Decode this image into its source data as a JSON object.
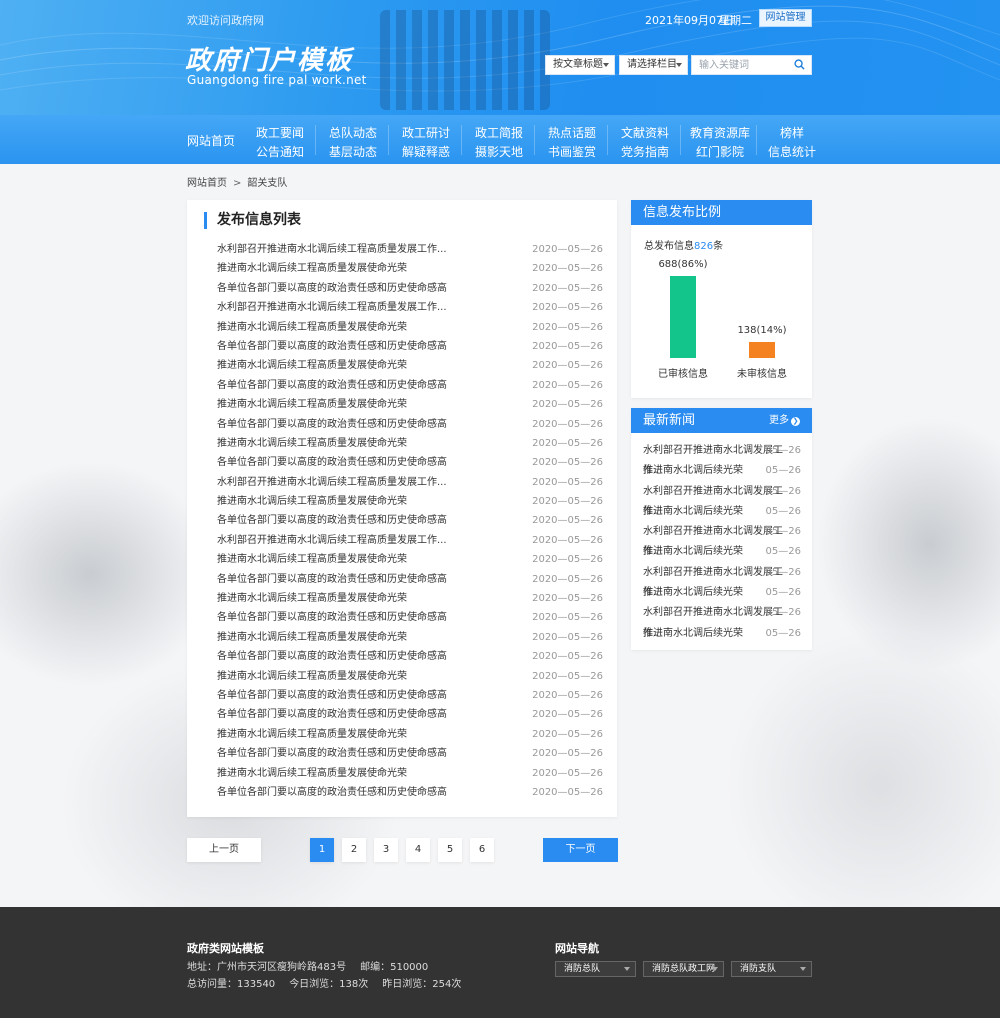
{
  "header": {
    "welcome": "欢迎访问政府网",
    "logo_title": "政府门户模板",
    "logo_sub": "Guangdong fire pal work.net",
    "date": "2021年09月07日",
    "week": "星期二",
    "admin_label": "网站管理",
    "select_title": "按文章标题",
    "select_column": "请选择栏目",
    "search_placeholder": "输入关键词"
  },
  "nav": {
    "home": "网站首页",
    "columns": [
      {
        "top": "政工要闻",
        "bottom": "公告通知"
      },
      {
        "top": "总队动态",
        "bottom": "基层动态"
      },
      {
        "top": "政工研讨",
        "bottom": "解疑释惑"
      },
      {
        "top": "政工简报",
        "bottom": "摄影天地"
      },
      {
        "top": "热点话题",
        "bottom": "书画鉴赏"
      },
      {
        "top": "文献资料",
        "bottom": "党务指南"
      },
      {
        "top": "教育资源库",
        "bottom": "红门影院"
      },
      {
        "top": "榜样",
        "bottom": "信息统计"
      }
    ]
  },
  "breadcrumb": {
    "home": "网站首页",
    "sep": ">",
    "current": "韶关支队"
  },
  "list": {
    "title": "发布信息列表",
    "rows": [
      {
        "title": "水利部召开推进南水北调后续工程高质量发展工作...",
        "date": "2020—05—26"
      },
      {
        "title": "推进南水北调后续工程高质量发展使命光荣",
        "date": "2020—05—26"
      },
      {
        "title": "各单位各部门要以高度的政治责任感和历史使命感高",
        "date": "2020—05—26"
      },
      {
        "title": "水利部召开推进南水北调后续工程高质量发展工作...",
        "date": "2020—05—26"
      },
      {
        "title": "推进南水北调后续工程高质量发展使命光荣",
        "date": "2020—05—26"
      },
      {
        "title": "各单位各部门要以高度的政治责任感和历史使命感高",
        "date": "2020—05—26"
      },
      {
        "title": "推进南水北调后续工程高质量发展使命光荣",
        "date": "2020—05—26"
      },
      {
        "title": "各单位各部门要以高度的政治责任感和历史使命感高",
        "date": "2020—05—26"
      },
      {
        "title": "推进南水北调后续工程高质量发展使命光荣",
        "date": "2020—05—26"
      },
      {
        "title": "各单位各部门要以高度的政治责任感和历史使命感高",
        "date": "2020—05—26"
      },
      {
        "title": "推进南水北调后续工程高质量发展使命光荣",
        "date": "2020—05—26"
      },
      {
        "title": "各单位各部门要以高度的政治责任感和历史使命感高",
        "date": "2020—05—26"
      },
      {
        "title": "水利部召开推进南水北调后续工程高质量发展工作...",
        "date": "2020—05—26"
      },
      {
        "title": "推进南水北调后续工程高质量发展使命光荣",
        "date": "2020—05—26"
      },
      {
        "title": "各单位各部门要以高度的政治责任感和历史使命感高",
        "date": "2020—05—26"
      },
      {
        "title": "水利部召开推进南水北调后续工程高质量发展工作...",
        "date": "2020—05—26"
      },
      {
        "title": "推进南水北调后续工程高质量发展使命光荣",
        "date": "2020—05—26"
      },
      {
        "title": "各单位各部门要以高度的政治责任感和历史使命感高",
        "date": "2020—05—26"
      },
      {
        "title": "推进南水北调后续工程高质量发展使命光荣",
        "date": "2020—05—26"
      },
      {
        "title": "各单位各部门要以高度的政治责任感和历史使命感高",
        "date": "2020—05—26"
      },
      {
        "title": "推进南水北调后续工程高质量发展使命光荣",
        "date": "2020—05—26"
      },
      {
        "title": "各单位各部门要以高度的政治责任感和历史使命感高",
        "date": "2020—05—26"
      },
      {
        "title": "推进南水北调后续工程高质量发展使命光荣",
        "date": "2020—05—26"
      },
      {
        "title": "各单位各部门要以高度的政治责任感和历史使命感高",
        "date": "2020—05—26"
      },
      {
        "title": "各单位各部门要以高度的政治责任感和历史使命感高",
        "date": "2020—05—26"
      },
      {
        "title": "推进南水北调后续工程高质量发展使命光荣",
        "date": "2020—05—26"
      },
      {
        "title": "各单位各部门要以高度的政治责任感和历史使命感高",
        "date": "2020—05—26"
      },
      {
        "title": "推进南水北调后续工程高质量发展使命光荣",
        "date": "2020—05—26"
      },
      {
        "title": "各单位各部门要以高度的政治责任感和历史使命感高",
        "date": "2020—05—26"
      }
    ]
  },
  "pagination": {
    "prev": "上一页",
    "next": "下一页",
    "pages": [
      "1",
      "2",
      "3",
      "4",
      "5",
      "6"
    ],
    "current": "1"
  },
  "stats": {
    "title": "信息发布比例",
    "total_prefix": "总发布信息",
    "total_num": "826",
    "total_suffix": "条"
  },
  "chart_data": {
    "type": "bar",
    "categories": [
      "已审核信息",
      "未审核信息"
    ],
    "values": [
      688,
      138
    ],
    "value_labels": [
      "688(86%)",
      "138(14%)"
    ],
    "colors": [
      "#13c48b",
      "#f58220"
    ],
    "ylim": [
      0,
      688
    ]
  },
  "news": {
    "title": "最新新闻",
    "more": "更多",
    "items": [
      {
        "title": "水利部召开推进南水北调发展工作...",
        "date": "05—26"
      },
      {
        "title": "推进南水北调后续光荣",
        "date": "05—26"
      },
      {
        "title": "水利部召开推进南水北调发展工作...",
        "date": "05—26"
      },
      {
        "title": "推进南水北调后续光荣",
        "date": "05—26"
      },
      {
        "title": "水利部召开推进南水北调发展工作...",
        "date": "05—26"
      },
      {
        "title": "推进南水北调后续光荣",
        "date": "05—26"
      },
      {
        "title": "水利部召开推进南水北调发展工作...",
        "date": "05—26"
      },
      {
        "title": "推进南水北调后续光荣",
        "date": "05—26"
      },
      {
        "title": "水利部召开推进南水北调发展工作...",
        "date": "05—26"
      },
      {
        "title": "推进南水北调后续光荣",
        "date": "05—26"
      }
    ]
  },
  "footer": {
    "title": "政府类网站模板",
    "address": "地址：广州市天河区瘦狗岭路483号",
    "postcode": "邮编：510000",
    "total_visits": "总访问量：133540",
    "today_visits": "今日浏览：138次",
    "yesterday_visits": "昨日浏览：254次",
    "nav_title": "网站导航",
    "nav_selects": [
      "消防总队",
      "消防总队政工网",
      "消防支队"
    ]
  },
  "colors": {
    "accent": "#2a8cf0",
    "footer_bg": "#333333"
  }
}
